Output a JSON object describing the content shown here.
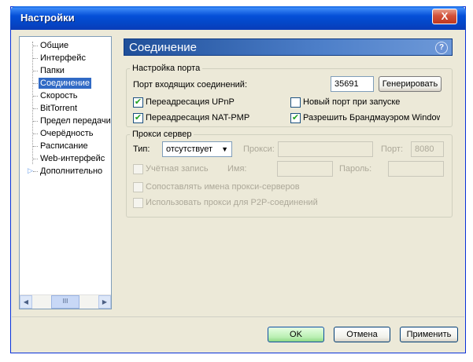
{
  "window": {
    "title": "Настройки",
    "close_label": "X"
  },
  "tree": {
    "items": [
      {
        "label": "Общие"
      },
      {
        "label": "Интерфейс"
      },
      {
        "label": "Папки"
      },
      {
        "label": "Соединение"
      },
      {
        "label": "Скорость"
      },
      {
        "label": "BitTorrent"
      },
      {
        "label": "Предел передачи"
      },
      {
        "label": "Очерёдность"
      },
      {
        "label": "Расписание"
      },
      {
        "label": "Web-интерфейс"
      },
      {
        "label": "Дополнительно"
      }
    ],
    "selected_index": 3,
    "scroll_thumb": "III"
  },
  "section": {
    "title": "Соединение",
    "help": "?"
  },
  "port_group": {
    "title": "Настройка порта",
    "incoming_port_label": "Порт входящих соединений:",
    "incoming_port_value": "35691",
    "generate_button": "Генерировать",
    "upnp_label": "Переадресация UPnP",
    "upnp_checked": true,
    "natpmp_label": "Переадресация NAT-PMP",
    "natpmp_checked": true,
    "random_port_label": "Новый порт при запуске",
    "random_port_checked": false,
    "firewall_label": "Разрешить Брандмауэром Windows",
    "firewall_checked": true
  },
  "proxy_group": {
    "title": "Прокси сервер",
    "type_label": "Тип:",
    "type_value": "отсутствует",
    "proxy_label": "Прокси:",
    "proxy_value": "",
    "port_label": "Порт:",
    "port_value": "8080",
    "auth_label": "Учётная запись",
    "name_label": "Имя:",
    "password_label": "Пароль:",
    "resolve_label": "Сопоставлять имена прокси-серверов",
    "p2p_label": "Использовать прокси для P2P-соединений"
  },
  "buttons": {
    "ok": "OK",
    "cancel": "Отмена",
    "apply": "Применить"
  }
}
